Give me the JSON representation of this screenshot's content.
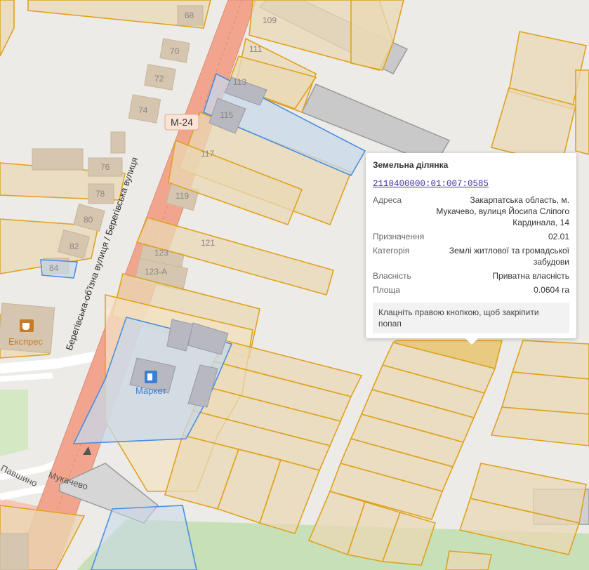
{
  "map": {
    "road_label": "Берегівська-об'їзна вулиця / Берегівська вулиця",
    "route_shield": "М-24",
    "street_labels": [
      "Павшино",
      "Мукачево"
    ],
    "house_numbers": [
      "68",
      "70",
      "72",
      "74",
      "76",
      "78",
      "80",
      "82",
      "84",
      "109",
      "111",
      "113",
      "115",
      "117",
      "119",
      "121",
      "123",
      "123-А"
    ],
    "pois": [
      {
        "name": "Експрес",
        "icon": "cafe-icon",
        "color": "#c87c2a"
      },
      {
        "name": "Маркет",
        "icon": "fuel-station-icon",
        "color": "#3b7fd4"
      }
    ],
    "colors": {
      "parcel_border": "#e0a21f",
      "parcel_fill": "#e9d8b4",
      "selected_parcel": "#e8c675",
      "highlight_parcel_border": "#4a8fe0",
      "highlight_parcel_fill": "#c8d8ea",
      "main_road": "#f2a58e",
      "building": "#d3cdc4"
    }
  },
  "popup": {
    "title": "Земельна ділянка",
    "cadastral_number": "2110400000:01:007:0585",
    "rows": [
      {
        "key": "Адреса",
        "value": "Закарпатська область, м. Мукачево, вулиця Йосипа Сліпого Кардинала, 14"
      },
      {
        "key": "Призначення",
        "value": "02.01"
      },
      {
        "key": "Категорія",
        "value": "Землі житлової та громадської забудови"
      },
      {
        "key": "Власність",
        "value": "Приватна власність"
      },
      {
        "key": "Площа",
        "value": "0.0604 га"
      }
    ],
    "hint": "Клацніть правою кнопкою, щоб закріпити попап"
  }
}
